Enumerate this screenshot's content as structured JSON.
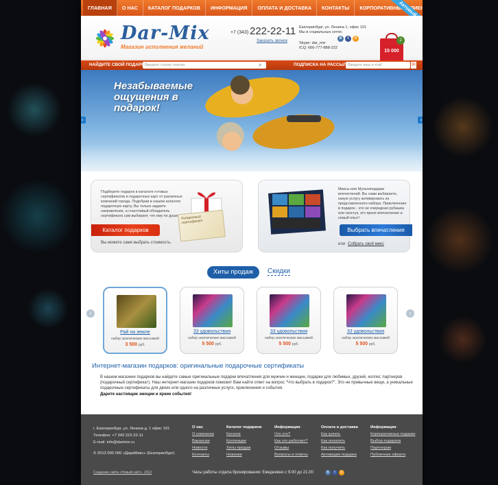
{
  "nav": {
    "items": [
      "ГЛАВНАЯ",
      "О НАС",
      "КАТАЛОГ ПОДАРКОВ",
      "ИНФОРМАЦИЯ",
      "ОПЛАТА И ДОСТАВКА",
      "КОНТАКТЫ",
      "КОРПОРАТИВНЫМ КЛИЕНТАМ"
    ],
    "active_index": 0,
    "ribbon": "Актовый"
  },
  "header": {
    "logo_text": "Dar-Mix",
    "logo_subtitle": "Магазин исполнения желаний",
    "phone_code": "+7 (343)",
    "phone_number": "222-22-11",
    "callback_link": "Заказать звонок",
    "address": "Екатеринбург, ул. Ленина 1, офис 101",
    "social_label": "Мы в социальных сетях:",
    "skype": "Skype: dar_mix",
    "icq": "ICQ: 666-777-888-222",
    "cart_total": "15 000",
    "cart_count": "2"
  },
  "search": {
    "label": "НАЙДИТЕ СВОЙ ПОДАРОК",
    "placeholder": "Введите строку поиска",
    "subscribe_label": "ПОДПИСКА НА РАССЫЛКУ",
    "subscribe_placeholder": "Введите ваш e-mail"
  },
  "hero": {
    "text": "Незабываемые ощущения в подарок!"
  },
  "promo_left": {
    "text": "Подберите подарок в каталоге готовых сертификатов и подарочных карт от различных компаний города. Подобрав в нашем каталоге подарочную карту, Вы только задаете направление, а счастливый обладатель сертификата сам выбирает, что ему по душе.",
    "button": "Каталог подарков",
    "note": "Вы можете сами выбрать стоимость.",
    "cert_label": "Подарочный сертификат"
  },
  "promo_right": {
    "text": "Миксы или Мультиподарки впечатлений. Вы сами выбираете, какую услугу активировать из представленного набора. Приключение в подарок - это не очередная рубашка или галстук, это яркое впечатление и новый опыт!",
    "button": "Выбрать впечатления",
    "or_text": "или",
    "link": "Собрать свой микс"
  },
  "tabs": {
    "active": "Хиты продаж",
    "other": "Скидки"
  },
  "products": [
    {
      "name": "Рай на земле",
      "sub": "набор экзотических массажей",
      "price": "3 500",
      "currency": "руб."
    },
    {
      "name": "33 удовольствия",
      "sub": "набор экзотических массажей",
      "price": "5 500",
      "currency": "руб."
    },
    {
      "name": "33 удовольствия",
      "sub": "набор экзотических массажей",
      "price": "5 500",
      "currency": "руб."
    },
    {
      "name": "33 удовольствия",
      "sub": "набор экзотических массажей",
      "price": "5 500",
      "currency": "руб."
    }
  ],
  "article": {
    "title": "Интернет-магазин подарков: оригинальные подарочные сертификаты",
    "body": "В нашем магазине подарков вы найдете самые оригинальные подарки впечатления для мужчин и женщин, подарки для любимых, друзей, коллег, партнеров (подарочный сертификат). Наш интернет-магазин подарков поможет Вам найти ответ на вопрос \"Что выбрать в подарок?\". Это не привычные вещи, а уникальные подарочные сертификаты для двоих или одного на различные услуги, приключения и события.",
    "bold": "Дарите настоящие эмоции и яркие события!"
  },
  "footer": {
    "address": "г. Екатеринбург,  ул. Ленина д. 1 офис 101",
    "phone": "Телефон: +7 343 222-22-11",
    "email": "E-mail: info@darimix.ru",
    "copyright": "© 2013 000 000 «ДариМикс» (Екатеринбург)",
    "creator": "Создание сайта «Новый сайт», 2013",
    "hours": "Часы работы отдела бронирования: Ежедневно с 9.00 до 21.00",
    "columns": [
      {
        "title": "О нас",
        "links": [
          "О компании",
          "Вакансии",
          "Новости",
          "Контакты"
        ]
      },
      {
        "title": "Каталог подарков",
        "links": [
          "Каталог",
          "Коллекции",
          "Хиты продаж",
          "Новинки"
        ]
      },
      {
        "title": "Информация",
        "links": [
          "Что это?",
          "Как это работает?",
          "Отзывы",
          "Вопросы и ответы"
        ]
      },
      {
        "title": "Оплата и доставка",
        "links": [
          "Как купить",
          "Как оплатить",
          "Как получить",
          "Активация подарка"
        ]
      },
      {
        "title": "Информация",
        "links": [
          "Корпоративные подарки",
          "Выбор подарков",
          "Партнерам",
          "Публичная оферта"
        ]
      }
    ]
  },
  "colors": {
    "accent_orange": "#e0501a",
    "brand_blue": "#1e5fa8",
    "footer_bg": "#4a4a4a"
  }
}
